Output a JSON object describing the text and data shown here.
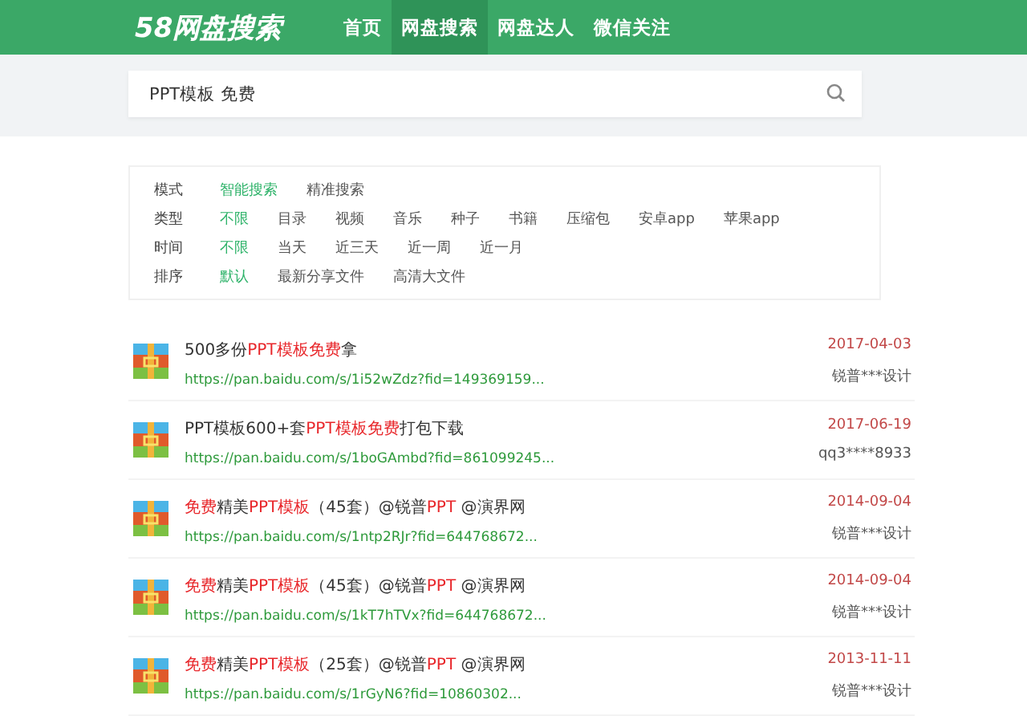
{
  "header": {
    "logo": "58网盘搜索",
    "nav": [
      {
        "label": "首页",
        "selected": false
      },
      {
        "label": "网盘搜索",
        "selected": true
      },
      {
        "label": "网盘达人",
        "selected": false
      },
      {
        "label": "微信关注",
        "selected": false
      }
    ]
  },
  "search": {
    "value": "PPT模板 免费"
  },
  "filters": [
    {
      "label": "模式",
      "options": [
        {
          "text": "智能搜索",
          "selected": true
        },
        {
          "text": "精准搜索",
          "selected": false
        }
      ]
    },
    {
      "label": "类型",
      "options": [
        {
          "text": "不限",
          "selected": true
        },
        {
          "text": "目录",
          "selected": false
        },
        {
          "text": "视频",
          "selected": false
        },
        {
          "text": "音乐",
          "selected": false
        },
        {
          "text": "种子",
          "selected": false
        },
        {
          "text": "书籍",
          "selected": false
        },
        {
          "text": "压缩包",
          "selected": false
        },
        {
          "text": "安卓app",
          "selected": false
        },
        {
          "text": "苹果app",
          "selected": false
        }
      ]
    },
    {
      "label": "时间",
      "options": [
        {
          "text": "不限",
          "selected": true
        },
        {
          "text": "当天",
          "selected": false
        },
        {
          "text": "近三天",
          "selected": false
        },
        {
          "text": "近一周",
          "selected": false
        },
        {
          "text": "近一月",
          "selected": false
        }
      ]
    },
    {
      "label": "排序",
      "options": [
        {
          "text": "默认",
          "selected": true
        },
        {
          "text": "最新分享文件",
          "selected": false
        },
        {
          "text": "高清大文件",
          "selected": false
        }
      ]
    }
  ],
  "results": [
    {
      "title_parts": [
        {
          "text": "500多份",
          "highlight": false
        },
        {
          "text": "PPT模板免费",
          "highlight": true
        },
        {
          "text": "拿",
          "highlight": false
        }
      ],
      "url": "https://pan.baidu.com/s/1i52wZdz?fid=149369159...",
      "date": "2017-04-03",
      "user": "锐普***设计"
    },
    {
      "title_parts": [
        {
          "text": "PPT模板600+套",
          "highlight": false
        },
        {
          "text": "PPT模板免费",
          "highlight": true
        },
        {
          "text": "打包下载",
          "highlight": false
        }
      ],
      "url": "https://pan.baidu.com/s/1boGAmbd?fid=861099245...",
      "date": "2017-06-19",
      "user": "qq3****8933"
    },
    {
      "title_parts": [
        {
          "text": "免费",
          "highlight": true
        },
        {
          "text": "精美",
          "highlight": false
        },
        {
          "text": "PPT模板",
          "highlight": true
        },
        {
          "text": "（45套）@锐普",
          "highlight": false
        },
        {
          "text": "PPT",
          "highlight": true
        },
        {
          "text": " @演界网",
          "highlight": false
        }
      ],
      "url": "https://pan.baidu.com/s/1ntp2RJr?fid=644768672...",
      "date": "2014-09-04",
      "user": "锐普***设计"
    },
    {
      "title_parts": [
        {
          "text": "免费",
          "highlight": true
        },
        {
          "text": "精美",
          "highlight": false
        },
        {
          "text": "PPT模板",
          "highlight": true
        },
        {
          "text": "（45套）@锐普",
          "highlight": false
        },
        {
          "text": "PPT",
          "highlight": true
        },
        {
          "text": " @演界网",
          "highlight": false
        }
      ],
      "url": "https://pan.baidu.com/s/1kT7hTVx?fid=644768672...",
      "date": "2014-09-04",
      "user": "锐普***设计"
    },
    {
      "title_parts": [
        {
          "text": "免费",
          "highlight": true
        },
        {
          "text": "精美",
          "highlight": false
        },
        {
          "text": "PPT模板",
          "highlight": true
        },
        {
          "text": "（25套）@锐普",
          "highlight": false
        },
        {
          "text": "PPT",
          "highlight": true
        },
        {
          "text": " @演界网",
          "highlight": false
        }
      ],
      "url": "https://pan.baidu.com/s/1rGyN6?fid=10860302...",
      "date": "2013-11-11",
      "user": "锐普***设计"
    }
  ]
}
